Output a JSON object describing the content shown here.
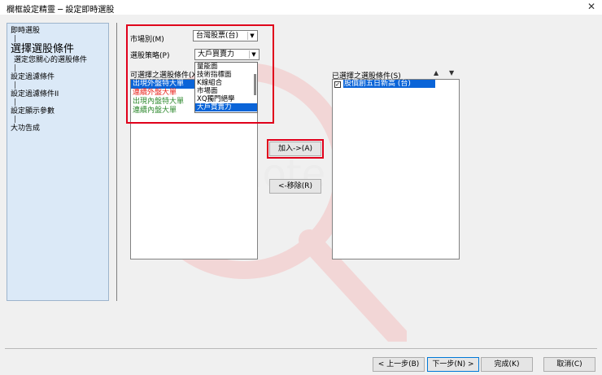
{
  "window": {
    "title": "欄框設定精靈 ─ 設定即時選股"
  },
  "steps": {
    "s1": "即時選股",
    "s2": "選擇選股條件",
    "s2_sub": "選定您關心的選股條件",
    "s3": "設定過濾條件",
    "s4": "設定過濾條件II",
    "s5": "設定顯示參數",
    "s6": "大功告成",
    "sep": "|"
  },
  "form": {
    "market_label": "市場別(M)",
    "market_value": "台灣股票(台)",
    "strategy_label": "選股策略(P)",
    "strategy_value": "大戶買賣力",
    "available_label": "可選擇之選股條件(X)",
    "selected_label": "已選擇之選股條件(S)"
  },
  "strategy_options": [
    "量能面",
    "技術指標面",
    "K線組合",
    "市場面",
    "XQ獨門絕學",
    "大戶買賣力"
  ],
  "available_items": [
    {
      "text": "出現外盤特大單",
      "color": "#ffffff"
    },
    {
      "text": "連續外盤大單",
      "color": "#e8231c"
    },
    {
      "text": "出現內盤特大單",
      "color": "#2f8a2f"
    },
    {
      "text": "連續內盤大單",
      "color": "#2f8a2f"
    }
  ],
  "selected_items": [
    {
      "text": "股價創五日新高 (台)",
      "checked": "✓"
    }
  ],
  "buttons": {
    "add": "加入->(A)",
    "remove": "<-移除(R)",
    "back": "< 上一步(B)",
    "next": "下一步(N) >",
    "finish": "完成(K)",
    "cancel": "取消(C)"
  },
  "colors": {
    "highlight": "#e0001b",
    "selection": "#0a64d8",
    "steps_bg": "#dbe9f7"
  }
}
